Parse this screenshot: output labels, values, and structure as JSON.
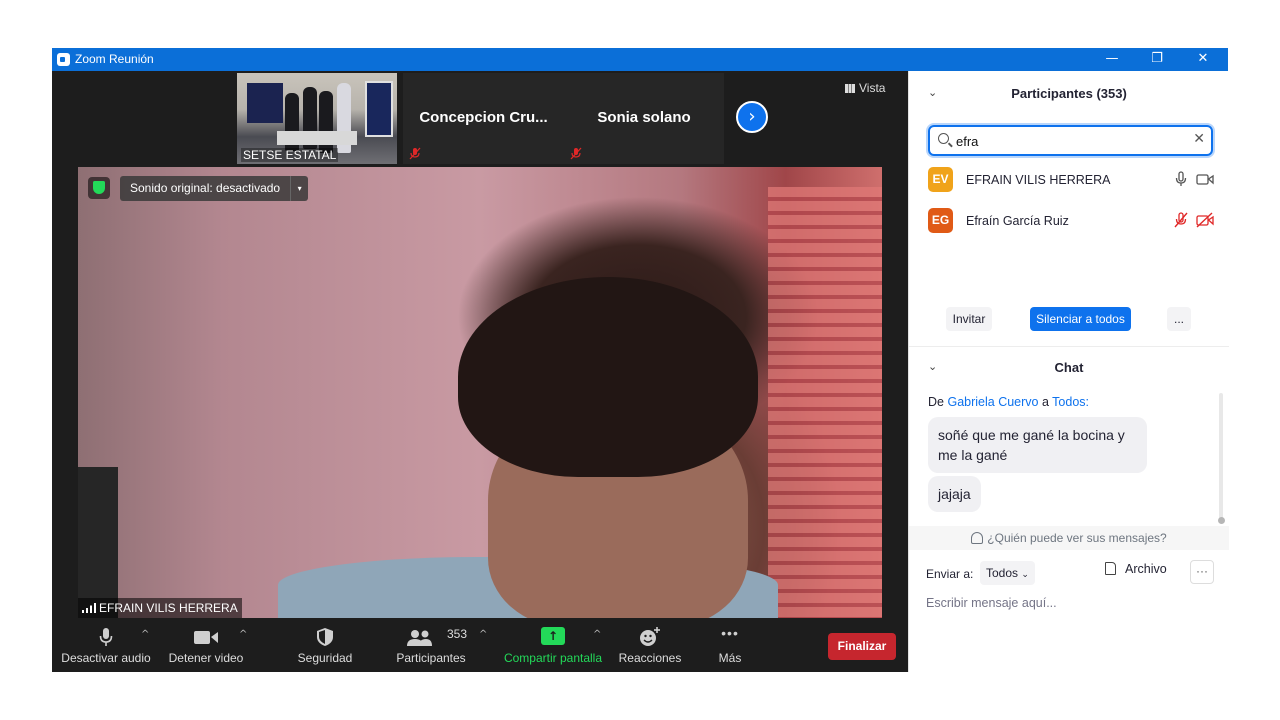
{
  "window": {
    "title": "Zoom Reunión",
    "minimize": "—",
    "restore": "❐",
    "close": "✕",
    "accent": "#0b6fd8"
  },
  "strip": {
    "thumbs": [
      {
        "name": "SETSE ESTATAL"
      },
      {
        "name": "Concepcion  Cru..."
      },
      {
        "name": "Sonia solano"
      }
    ],
    "next": "›",
    "view": "Vista"
  },
  "video": {
    "sound_original": "Sonido original: desactivado",
    "caret": "▾",
    "speaker_name": "EFRAIN VILIS HERRERA"
  },
  "toolbar": {
    "audio_label": "Desactivar audio",
    "video_label": "Detener video",
    "security_label": "Seguridad",
    "participants_label": "Participantes",
    "participants_count": "353",
    "share_label": "Compartir pantalla",
    "share_icon": "↑",
    "reactions_label": "Reacciones",
    "more_label": "Más",
    "more_icon": "•••",
    "caret": "^",
    "end_label": "Finalizar",
    "end_color": "#c6262e",
    "share_color": "#23d959"
  },
  "participants_panel": {
    "chevron": "⌄",
    "title": "Participantes (353)",
    "search_value": "efra",
    "clear": "✕",
    "participants": [
      {
        "initials": "EV",
        "name": "EFRAIN VILIS HERRERA",
        "color": "#f0a31a",
        "muted": false
      },
      {
        "initials": "EG",
        "name": "Efraín García Ruiz",
        "color": "#e05a16",
        "muted": true
      }
    ],
    "invite": "Invitar",
    "mute_all": "Silenciar a todos",
    "more": "..."
  },
  "chat": {
    "chevron": "⌄",
    "title": "Chat",
    "from_prefix": "De",
    "from_user": "Gabriela Cuervo",
    "to_word": "a",
    "to_target": "Todos:",
    "messages": [
      "soñé que me gané la bocina y me la gané",
      "jajaja"
    ],
    "privacy": "¿Quién puede ver sus mensajes?",
    "send_to_label": "Enviar a:",
    "send_to_value": "Todos",
    "send_caret": "⌄",
    "file_label": "Archivo",
    "more": "···",
    "input_placeholder": "Escribir mensaje aquí..."
  }
}
